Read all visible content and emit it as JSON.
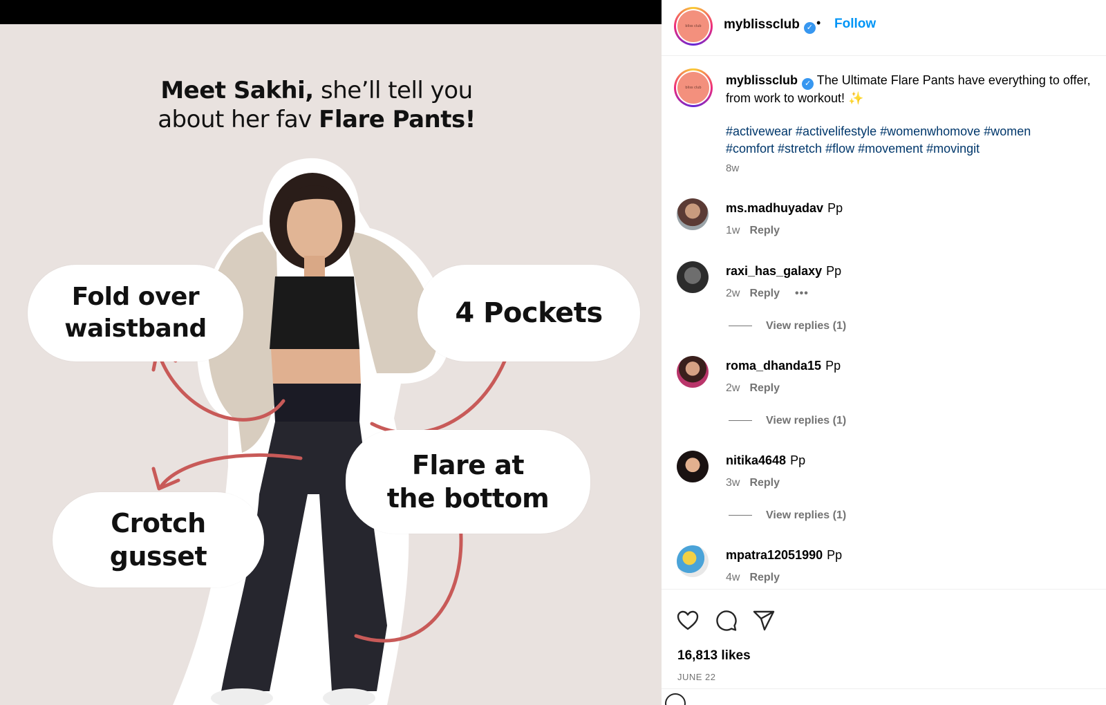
{
  "media": {
    "headline_bold_1": "Meet Sakhi,",
    "headline_regular_1": " she’ll tell you",
    "headline_regular_2": "about her fav ",
    "headline_bold_2": "Flare Pants!",
    "bubbles": {
      "waistband_line1": "Fold over",
      "waistband_line2": "waistband",
      "pockets": "4 Pockets",
      "flare_line1": "Flare at",
      "flare_line2": "the bottom",
      "crotch_line1": "Crotch",
      "crotch_line2": "gusset"
    },
    "colors": {
      "background": "#e9e2df",
      "arrow": "#c85a58",
      "bubble": "#ffffff"
    }
  },
  "header": {
    "avatar_text": "bliss club",
    "username": "myblissclub",
    "separator": "•",
    "follow_label": "Follow"
  },
  "caption": {
    "username": "myblissclub",
    "text": "The Ultimate Flare Pants have everything to offer, from work to workout! ✨",
    "hashtags": [
      "#activewear",
      "#activelifestyle",
      "#womenwhomove",
      "#women",
      "#comfort",
      "#stretch",
      "#flow",
      "#movement",
      "#movingit"
    ],
    "time": "8w"
  },
  "comments": [
    {
      "username": "ms.madhuyadav",
      "text": "Pp",
      "time": "1w",
      "reply_label": "Reply"
    },
    {
      "username": "raxi_has_galaxy",
      "text": "Pp",
      "time": "2w",
      "reply_label": "Reply",
      "more": "•••",
      "view_replies": "View replies (1)"
    },
    {
      "username": "roma_dhanda15",
      "text": "Pp",
      "time": "2w",
      "reply_label": "Reply",
      "view_replies": "View replies (1)"
    },
    {
      "username": "nitika4648",
      "text": "Pp",
      "time": "3w",
      "reply_label": "Reply",
      "view_replies": "View replies (1)"
    },
    {
      "username": "mpatra12051990",
      "text": "Pp",
      "time": "4w",
      "reply_label": "Reply"
    }
  ],
  "actions": {
    "icons": [
      "heart-icon",
      "comment-icon",
      "share-icon"
    ],
    "likes": "16,813 likes",
    "date": "JUNE 22"
  },
  "colors": {
    "link": "#0095f6",
    "hashtag": "#00376b",
    "muted": "#737373",
    "verified": "#3797f0"
  }
}
